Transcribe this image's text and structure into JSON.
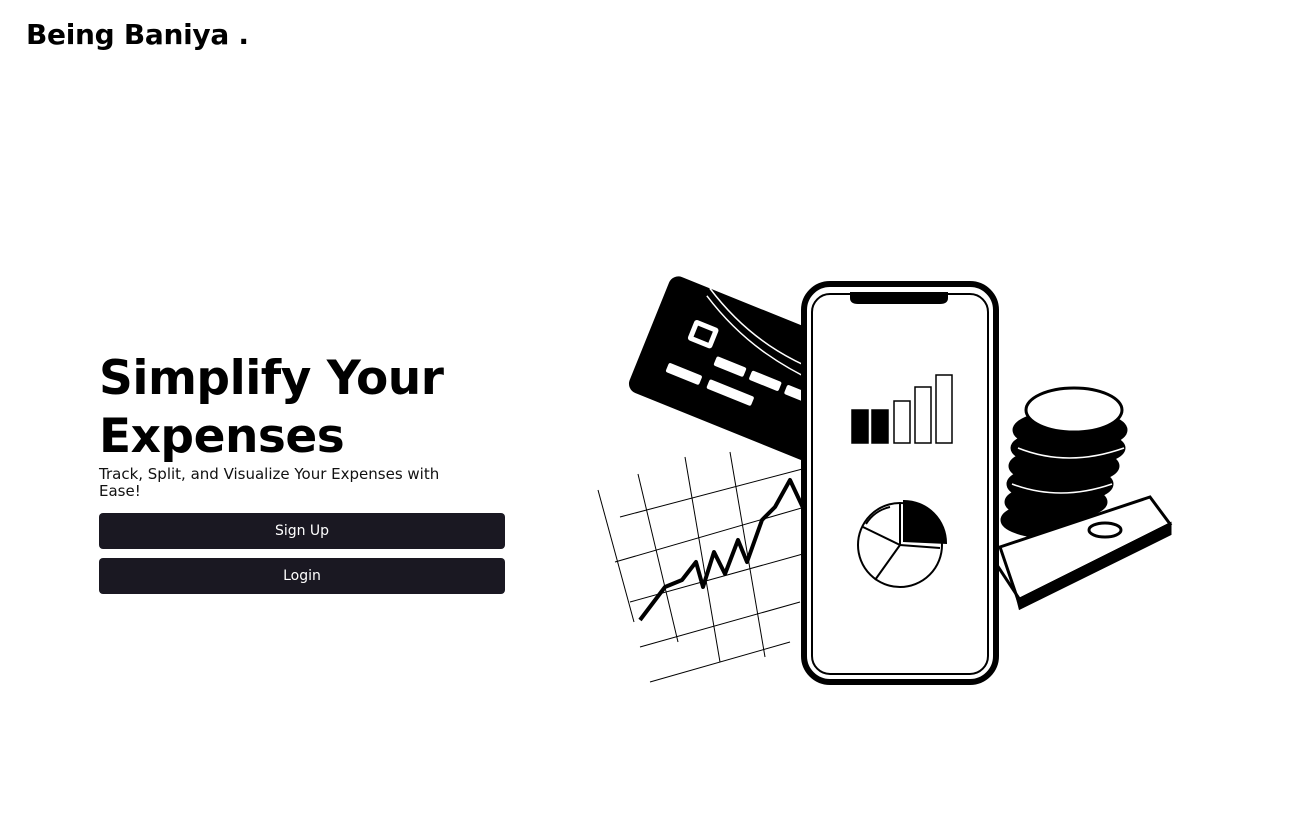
{
  "header": {
    "brand": "Being Baniya ."
  },
  "hero": {
    "title_line1": "Simplify Your",
    "title_line2": "Expenses",
    "subtitle": "Track, Split, and Visualize Your Expenses with Ease!",
    "signup_label": "Sign Up",
    "login_label": "Login"
  },
  "illustration": {
    "name": "finance-illustration",
    "elements": [
      "credit-card",
      "smartphone",
      "bar-chart",
      "pie-chart",
      "coin-stack",
      "banknote-bundle",
      "stock-chart"
    ]
  },
  "colors": {
    "background": "#ffffff",
    "text": "#000000",
    "button_bg": "#1a1822",
    "button_text": "#ffffff"
  }
}
